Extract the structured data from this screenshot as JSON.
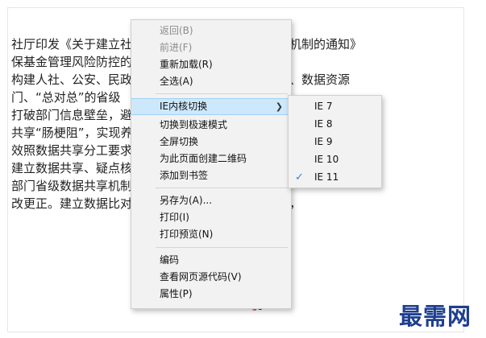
{
  "article": {
    "lines": [
      "社厅印发《关于建立社会保险基金数据共享比对工作机制的通知》",
      "保基金管理风险防控的",
      "构建人社、公安、民政、司法、交通运输、卫生健康、数据资源",
      "门、“总对总”的省级",
      "打破部门信息壁垒，避免死亡冒领、服刑、重点人群",
      "共享“肠梗阻”，实现养老保险、失业",
      "效照数据共享分工要求，确保推送数据，合",
      "建立数据共享、疑点核查中心数据资源",
      "部门省级数据共享机制。对通过数据比对发现的疑点",
      "改更正。建立数据比对进展，研究数据比对存在问题，"
    ],
    "red_text": "」】"
  },
  "context_menu": {
    "items": [
      {
        "label": "返回(B)",
        "disabled": true
      },
      {
        "label": "前进(F)",
        "disabled": true
      },
      {
        "label": "重新加载(R)",
        "disabled": false
      },
      {
        "label": "全选(A)",
        "disabled": false
      },
      {
        "label": "IE内核切换",
        "disabled": false,
        "submenu": true,
        "highlight": true
      },
      {
        "label": "切换到极速模式",
        "disabled": false
      },
      {
        "label": "全屏切换",
        "disabled": false
      },
      {
        "label": "为此页面创建二维码",
        "disabled": false
      },
      {
        "label": "添加到书签",
        "disabled": false
      },
      {
        "label": "另存为(A)...",
        "disabled": false
      },
      {
        "label": "打印(I)",
        "disabled": false
      },
      {
        "label": "打印预览(N)",
        "disabled": false
      },
      {
        "label": "编码",
        "disabled": false
      },
      {
        "label": "查看网页源代码(V)",
        "disabled": false
      },
      {
        "label": "属性(P)",
        "disabled": false
      }
    ]
  },
  "ie_submenu": {
    "items": [
      {
        "label": "IE 7",
        "checked": false
      },
      {
        "label": "IE 8",
        "checked": false
      },
      {
        "label": "IE 9",
        "checked": false
      },
      {
        "label": "IE 10",
        "checked": false
      },
      {
        "label": "IE 11",
        "checked": true
      }
    ]
  },
  "watermark": "最需网",
  "icons": {
    "submenu_arrow": "chevron-right-icon",
    "checkmark": "checkmark-icon"
  }
}
